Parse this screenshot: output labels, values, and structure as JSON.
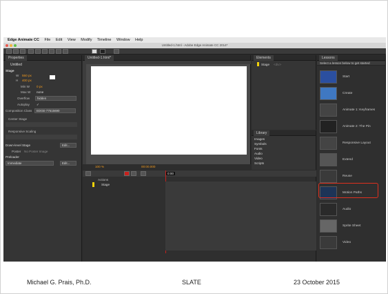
{
  "menubar": {
    "app_name": "Edge Animate CC",
    "items": [
      "File",
      "Edit",
      "View",
      "Modify",
      "Timeline",
      "Window",
      "Help"
    ]
  },
  "window": {
    "title": "Untitled-1.html - Adobe Edge Animate CC 2014*"
  },
  "properties": {
    "tab": "Properties",
    "doc_title": "Untitled",
    "section_stage": "Stage",
    "width_label": "W",
    "width_value": "550 px",
    "height_label": "H",
    "height_value": "400 px",
    "minw_label": "Min W",
    "minw_value": "0 px",
    "maxw_label": "Max W",
    "maxw_value": "none",
    "overflow_label": "Overflow",
    "overflow_value": "hidden",
    "autoplay_label": "Autoplay",
    "autoplay_value": "✓",
    "composition_label": "Composition Class",
    "composition_value": "EDGE-77615690",
    "center_stage": "Center Stage",
    "responsive_scaling": "Responsive Scaling",
    "downlevel_label": "Down-level Stage",
    "downlevel_button": "Edit...",
    "poster_label": "Poster",
    "poster_value": "No Poster Image",
    "preloader_label": "Preloader",
    "preloader_value": "Immediate",
    "preloader_button": "Edit..."
  },
  "stage_tab": "Untitled-1.html*",
  "stage_zoom": "100 %",
  "timecode": "00:00.000",
  "elements": {
    "tab": "Elements",
    "stage_item": "Stage",
    "stage_tag": "<div>"
  },
  "library": {
    "tab": "Library",
    "items": [
      "Images",
      "Symbols",
      "Fonts",
      "Audio",
      "Video",
      "Scripts"
    ]
  },
  "timeline": {
    "actions_label": "Actions",
    "stage_row": "Stage",
    "playhead": "0:00"
  },
  "lessons": {
    "tab": "Lessons",
    "subtitle": "Select a lesson below to get started",
    "items": [
      "Start",
      "Create",
      "Animate 1: Keyframes",
      "Animate 2: The Pin",
      "Responsive Layout",
      "Extend",
      "Reuse",
      "Motion Paths",
      "Audio",
      "Sprite Sheet",
      "Video"
    ],
    "highlighted": "Motion Paths"
  },
  "footer": {
    "author": "Michael G. Prais, Ph.D.",
    "center": "SLATE",
    "date": "23 October 2015"
  },
  "colors": {
    "accent_orange": "#f29a1e",
    "highlight_red": "#e0301e",
    "playhead_red": "#c8201c"
  }
}
